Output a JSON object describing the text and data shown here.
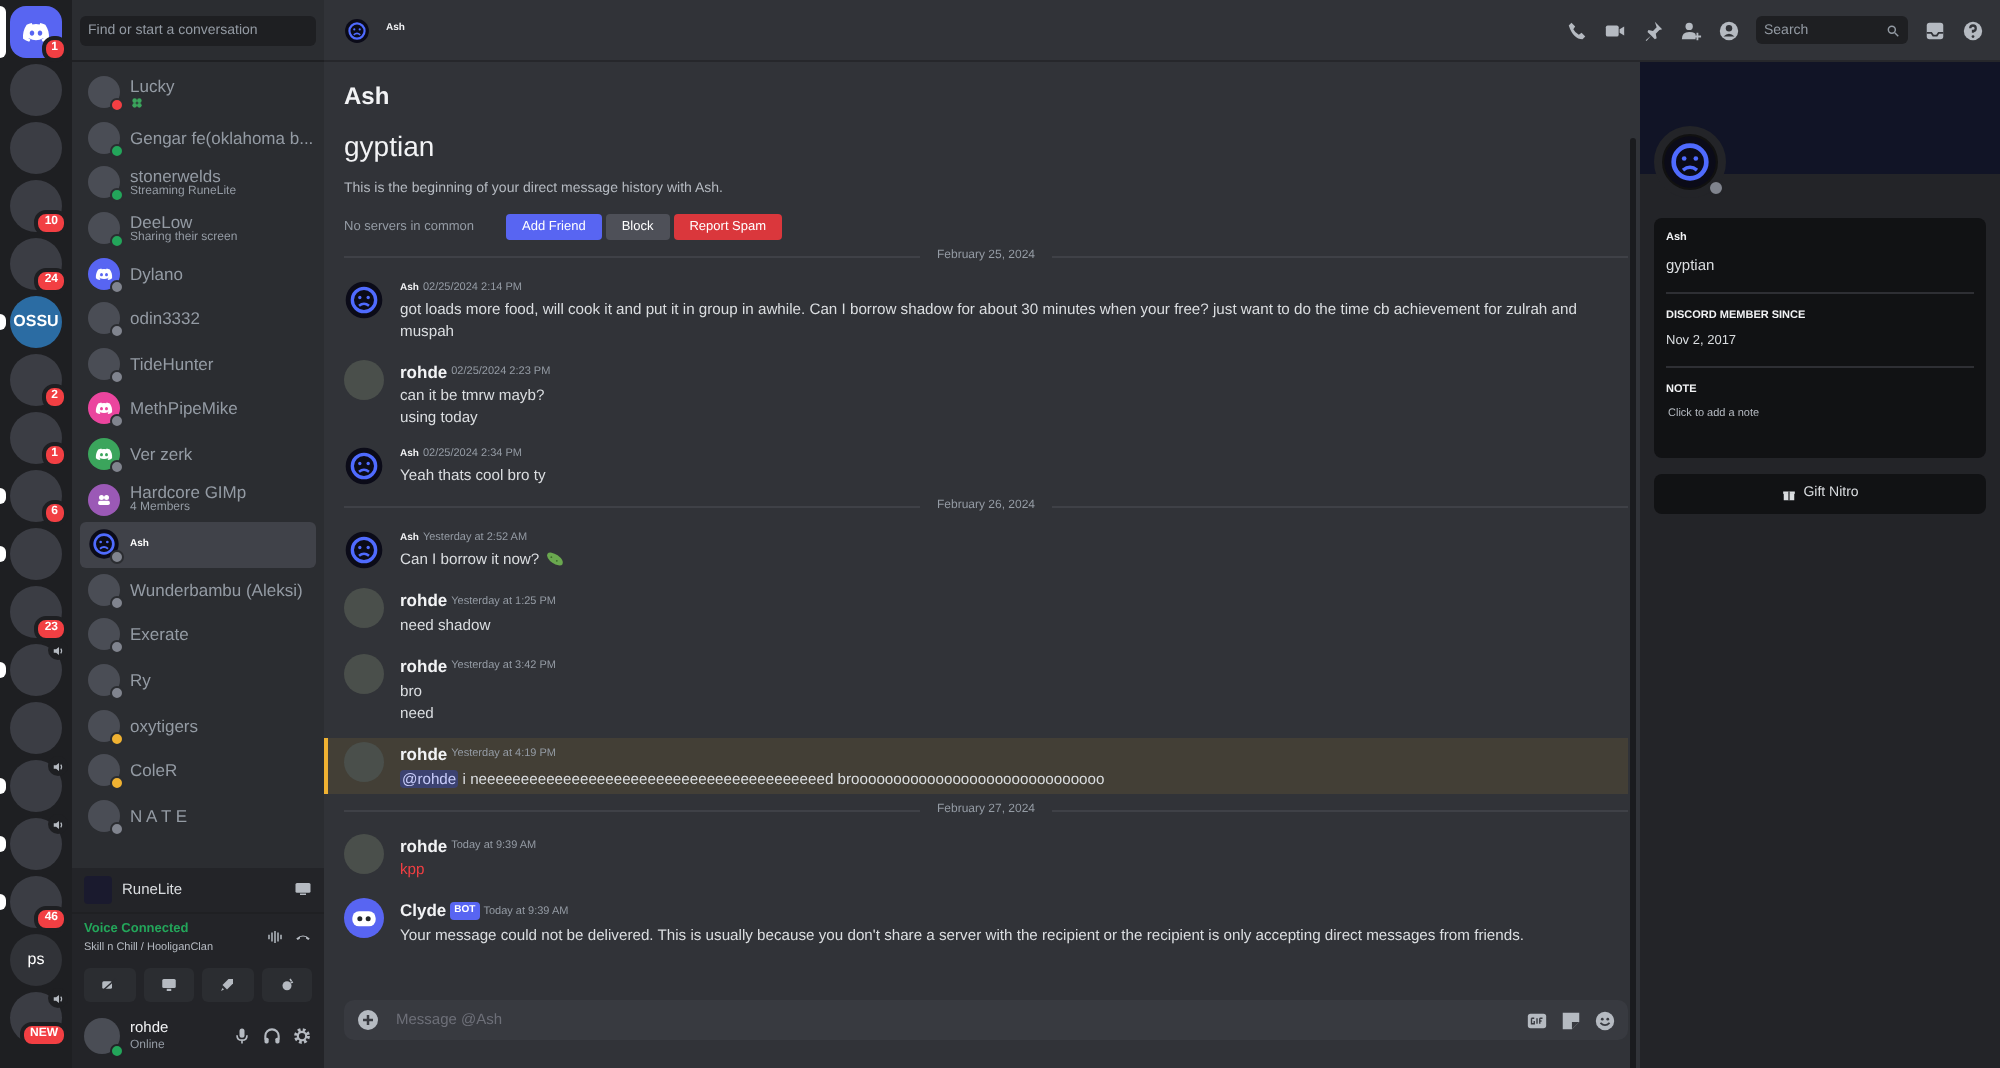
{
  "servers": [
    {
      "kind": "home",
      "badge": "1",
      "unread": false,
      "selected": true,
      "voice": false
    },
    {
      "kind": "photo",
      "unread": false,
      "selected": false,
      "voice": false
    },
    {
      "kind": "photo",
      "unread": false,
      "selected": false,
      "voice": false
    },
    {
      "kind": "photo",
      "badge": "10",
      "unread": false,
      "selected": false,
      "voice": false
    },
    {
      "kind": "photo",
      "badge": "24",
      "unread": false,
      "selected": false,
      "voice": false
    },
    {
      "kind": "label",
      "label": "OSSU",
      "unread": true,
      "selected": false,
      "voice": false
    },
    {
      "kind": "photo",
      "badge": "2",
      "unread": false,
      "selected": false,
      "voice": false
    },
    {
      "kind": "photo",
      "badge": "1",
      "unread": false,
      "selected": false,
      "voice": false
    },
    {
      "kind": "photo",
      "badge": "6",
      "unread": true,
      "selected": false,
      "voice": false
    },
    {
      "kind": "photo",
      "unread": true,
      "selected": false,
      "voice": false
    },
    {
      "kind": "photo",
      "badge": "23",
      "unread": false,
      "selected": false,
      "voice": false
    },
    {
      "kind": "photo",
      "unread": true,
      "selected": false,
      "voice": true
    },
    {
      "kind": "photo",
      "unread": false,
      "selected": false,
      "voice": false
    },
    {
      "kind": "photo",
      "unread": true,
      "selected": false,
      "voice": true
    },
    {
      "kind": "photo",
      "unread": true,
      "selected": false,
      "voice": true
    },
    {
      "kind": "photo",
      "badge": "46",
      "unread": true,
      "selected": false,
      "voice": false
    },
    {
      "kind": "label",
      "label": "ps",
      "unread": false,
      "selected": false,
      "voice": false
    },
    {
      "kind": "photo",
      "badge": "NEW",
      "unread": false,
      "selected": false,
      "voice": true
    }
  ],
  "dm_search": {
    "placeholder": "Find or start a conversation"
  },
  "dms": [
    {
      "name": "Lucky",
      "status_dot": {
        "color": "#f23f43"
      },
      "status_icon": true,
      "selected": false
    },
    {
      "name": "Gengar fe(oklahoma b...",
      "status_dot": {
        "color": "#23a55a"
      },
      "selected": false
    },
    {
      "name": "stonerwelds",
      "subtext": "Streaming RuneLite",
      "status_dot": {
        "color": "#23a55a"
      },
      "selected": false
    },
    {
      "name": "DeeLow",
      "subtext": "Sharing their screen",
      "status_dot": {
        "color": "#23a55a"
      },
      "selected": false
    },
    {
      "name": "Dylano",
      "status_dot": {
        "color": "#80848e"
      },
      "avatar": {
        "kind": "logo",
        "color": "#5865f2"
      },
      "selected": false
    },
    {
      "name": "odin3332",
      "status_dot": {
        "color": "#80848e"
      },
      "selected": false
    },
    {
      "name": "TideHunter",
      "status_dot": {
        "color": "#80848e"
      },
      "selected": false
    },
    {
      "name": "MethPipeMike",
      "status_dot": {
        "color": "#80848e"
      },
      "avatar": {
        "kind": "logo",
        "color": "#eb459e"
      },
      "selected": false
    },
    {
      "name": "Ver zerk",
      "status_dot": {
        "color": "#80848e"
      },
      "avatar": {
        "kind": "logo",
        "color": "#3ba55c"
      },
      "selected": false
    },
    {
      "name": "Hardcore GIMp",
      "subtext": "4 Members",
      "avatar": {
        "kind": "group",
        "color": "#9b59b6"
      },
      "selected": false
    },
    {
      "name": "Ash",
      "status_dot": {
        "color": "#80848e"
      },
      "avatar": {
        "kind": "sad"
      },
      "tiny": true,
      "selected": true
    },
    {
      "name": "Wunderbambu (Aleksi)",
      "status_dot": {
        "color": "#80848e"
      },
      "selected": false
    },
    {
      "name": "Exerate",
      "status_dot": {
        "color": "#80848e"
      },
      "selected": false
    },
    {
      "name": "Ry",
      "status_dot": {
        "color": "#80848e"
      },
      "selected": false
    },
    {
      "name": "oxytigers",
      "status_dot": {
        "color": "#f0b232"
      },
      "selected": false
    },
    {
      "name": "ColeR",
      "status_dot": {
        "color": "#f0b232"
      },
      "selected": false
    },
    {
      "name": "N A T E",
      "status_dot": {
        "color": "#80848e"
      },
      "selected": false
    }
  ],
  "activity": {
    "name": "RuneLite"
  },
  "voice": {
    "title": "Voice Connected",
    "channel": "Skill n Chill / HooliganClan"
  },
  "user": {
    "name": "rohde",
    "status": "Online"
  },
  "header": {
    "name": "Ash",
    "search_placeholder": "Search"
  },
  "intro": {
    "display_name": "Ash",
    "username": "gyptian",
    "text": "This is the beginning of your direct message history with Ash.",
    "mutual": "No servers in common",
    "buttons": [
      {
        "label": "Add Friend",
        "kind": "primary"
      },
      {
        "label": "Block",
        "kind": "secondary"
      },
      {
        "label": "Report Spam",
        "kind": "danger"
      }
    ]
  },
  "messages": [
    {
      "kind": "divider",
      "text": "February 25, 2024"
    },
    {
      "kind": "message",
      "author": "Ash",
      "avatar": {
        "kind": "ash"
      },
      "tiny": true,
      "time": "02/25/2024 2:14 PM",
      "lines": [
        {
          "text": "got loads more food, will cook it and put it in group in awhile. Can I borrow shadow for about 30 minutes when your free? just want to do the time cb achievement for zulrah and muspah"
        }
      ]
    },
    {
      "kind": "message",
      "author": "rohde",
      "avatar": {
        "kind": "photo"
      },
      "time": "02/25/2024 2:23 PM",
      "lines": [
        {
          "text": "can it be tmrw mayb?"
        },
        {
          "text": "using today"
        }
      ]
    },
    {
      "kind": "message",
      "author": "Ash",
      "avatar": {
        "kind": "ash"
      },
      "tiny": true,
      "time": "02/25/2024 2:34 PM",
      "lines": [
        {
          "text": "Yeah thats cool bro ty"
        }
      ]
    },
    {
      "kind": "divider",
      "text": "February 26, 2024"
    },
    {
      "kind": "message",
      "author": "Ash",
      "avatar": {
        "kind": "ash"
      },
      "tiny": true,
      "time": "Yesterday at 2:52 AM",
      "lines": [
        {
          "text": "Can I borrow it now?",
          "emoji": true
        }
      ]
    },
    {
      "kind": "message",
      "author": "rohde",
      "avatar": {
        "kind": "photo"
      },
      "time": "Yesterday at 1:25 PM",
      "lines": [
        {
          "text": "need shadow"
        }
      ]
    },
    {
      "kind": "message",
      "author": "rohde",
      "avatar": {
        "kind": "photo"
      },
      "time": "Yesterday at 3:42 PM",
      "lines": [
        {
          "text": "bro"
        },
        {
          "text": "need"
        }
      ]
    },
    {
      "kind": "message",
      "author": "rohde",
      "avatar": {
        "kind": "photo"
      },
      "time": "Yesterday at 4:19 PM",
      "mentioned": true,
      "lines": [
        {
          "mention": "@rohde",
          "text": "i neeeeeeeeeeeeeeeeeeeeeeeeeeeeeeeeeeeeeeeeed broooooooooooooooooooooooooooooo"
        }
      ]
    },
    {
      "kind": "divider",
      "text": "February 27, 2024"
    },
    {
      "kind": "message",
      "author": "rohde",
      "avatar": {
        "kind": "photo"
      },
      "time": "Today at 9:39 AM",
      "lines": [
        {
          "text": "kpp",
          "failed": true
        }
      ]
    },
    {
      "kind": "message",
      "author": "Clyde",
      "avatar": {
        "kind": "bot"
      },
      "tag": "BOT",
      "time": "Today at 9:39 AM",
      "lines": [
        {
          "text": "Your message could not be delivered. This is usually because you don't share a server with the recipient or the recipient is only accepting direct messages from friends."
        }
      ]
    }
  ],
  "composer": {
    "placeholder": "Message @Ash"
  },
  "profile": {
    "display_name": "Ash",
    "username": "gyptian",
    "sections": [
      {
        "title": "DISCORD MEMBER SINCE",
        "value": "Nov 2, 2017"
      },
      {
        "title": "NOTE",
        "value": "Click to add a note",
        "kind": "note"
      }
    ],
    "gift": "Gift Nitro"
  }
}
